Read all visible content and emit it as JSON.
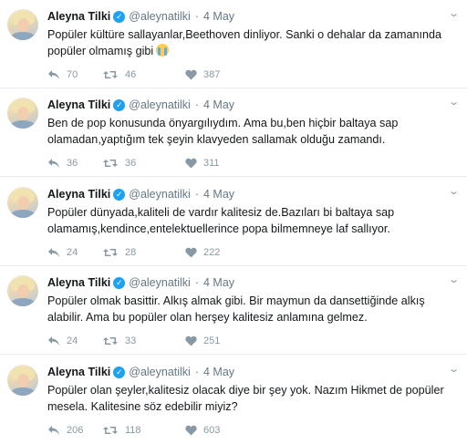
{
  "tweets": [
    {
      "name": "Aleyna Tilki",
      "handle": "@aleynatilki",
      "separator": "·",
      "time": "4 May",
      "text": "Popüler kültüre sallayanlar,Beethoven dinliyor. Sanki o dehalar da zamanında popüler olmamış gibi",
      "emoji": "loudly-crying-face-emoji",
      "replies": "70",
      "retweets": "46",
      "likes": "387"
    },
    {
      "name": "Aleyna Tilki",
      "handle": "@aleynatilki",
      "separator": "·",
      "time": "4 May",
      "text": "Ben de pop konusunda önyargılıydım. Ama bu,ben hiçbir baltaya sap olamadan,yaptığım tek şeyin klavyeden sallamak olduğu zamandı.",
      "replies": "36",
      "retweets": "36",
      "likes": "311"
    },
    {
      "name": "Aleyna Tilki",
      "handle": "@aleynatilki",
      "separator": "·",
      "time": "4 May",
      "text": "Popüler dünyada,kaliteli de vardır kalitesiz de.Bazıları bi baltaya sap olamamış,kendince,entelektuellerince popa bilmemneye laf sallıyor.",
      "replies": "24",
      "retweets": "28",
      "likes": "222"
    },
    {
      "name": "Aleyna Tilki",
      "handle": "@aleynatilki",
      "separator": "·",
      "time": "4 May",
      "text": "Popüler olmak basittir. Alkış almak gibi. Bir maymun da dansettiğinde alkış alabilir. Ama bu popüler olan herşey kalitesiz anlamına gelmez.",
      "replies": "24",
      "retweets": "33",
      "likes": "251"
    },
    {
      "name": "Aleyna Tilki",
      "handle": "@aleynatilki",
      "separator": "·",
      "time": "4 May",
      "text": "Popüler olan şeyler,kalitesiz olacak diye bir şey yok. Nazım Hikmet de popüler mesela. Kalitesine söz edebilir miyiz?",
      "replies": "206",
      "retweets": "118",
      "likes": "603"
    }
  ],
  "icons": {
    "verified": "verified-badge-icon",
    "caret": "chevron-down-icon",
    "reply": "reply-icon",
    "retweet": "retweet-icon",
    "like": "heart-icon"
  },
  "colors": {
    "verified": "#1da1f2",
    "muted": "#657786",
    "action": "#8899a6",
    "divider": "#e6ecf0",
    "text": "#14171a"
  }
}
